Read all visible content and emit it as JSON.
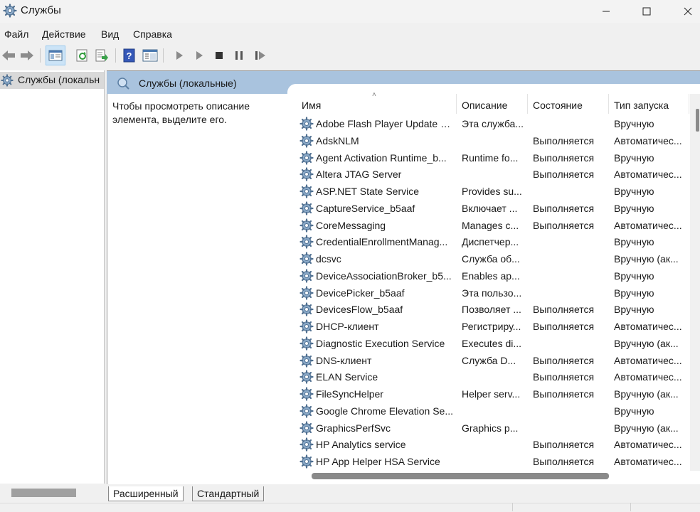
{
  "window": {
    "title": "Службы"
  },
  "menu": {
    "items": [
      "Файл",
      "Действие",
      "Вид",
      "Справка"
    ]
  },
  "tree": {
    "label": "Службы (локальн"
  },
  "panel": {
    "title": "Службы (локальные)",
    "description": "Чтобы просмотреть описание элемента, выделите его."
  },
  "table": {
    "columns": [
      "Имя",
      "Описание",
      "Состояние",
      "Тип запуска"
    ],
    "rows": [
      {
        "name": "Adobe Flash Player Update S...",
        "desc": "Эта служба...",
        "state": "",
        "start": "Вручную"
      },
      {
        "name": "AdskNLM",
        "desc": "",
        "state": "Выполняется",
        "start": "Автоматичес..."
      },
      {
        "name": "Agent Activation Runtime_b...",
        "desc": "Runtime fo...",
        "state": "Выполняется",
        "start": "Вручную"
      },
      {
        "name": "Altera JTAG Server",
        "desc": "",
        "state": "Выполняется",
        "start": "Автоматичес..."
      },
      {
        "name": "ASP.NET State Service",
        "desc": "Provides su...",
        "state": "",
        "start": "Вручную"
      },
      {
        "name": "CaptureService_b5aaf",
        "desc": "Включает ...",
        "state": "Выполняется",
        "start": "Вручную"
      },
      {
        "name": "CoreMessaging",
        "desc": "Manages c...",
        "state": "Выполняется",
        "start": "Автоматичес..."
      },
      {
        "name": "CredentialEnrollmentManag...",
        "desc": "Диспетчер...",
        "state": "",
        "start": "Вручную"
      },
      {
        "name": "dcsvc",
        "desc": "Служба об...",
        "state": "",
        "start": "Вручную (ак..."
      },
      {
        "name": "DeviceAssociationBroker_b5...",
        "desc": "Enables ap...",
        "state": "",
        "start": "Вручную"
      },
      {
        "name": "DevicePicker_b5aaf",
        "desc": "Эта пользо...",
        "state": "",
        "start": "Вручную"
      },
      {
        "name": "DevicesFlow_b5aaf",
        "desc": "Позволяет ...",
        "state": "Выполняется",
        "start": "Вручную"
      },
      {
        "name": "DHCP-клиент",
        "desc": "Регистриру...",
        "state": "Выполняется",
        "start": "Автоматичес..."
      },
      {
        "name": "Diagnostic Execution Service",
        "desc": "Executes di...",
        "state": "",
        "start": "Вручную (ак..."
      },
      {
        "name": "DNS-клиент",
        "desc": "Служба D...",
        "state": "Выполняется",
        "start": "Автоматичес..."
      },
      {
        "name": "ELAN Service",
        "desc": "",
        "state": "Выполняется",
        "start": "Автоматичес..."
      },
      {
        "name": "FileSyncHelper",
        "desc": "Helper serv...",
        "state": "Выполняется",
        "start": "Вручную (ак..."
      },
      {
        "name": "Google Chrome Elevation Se...",
        "desc": "",
        "state": "",
        "start": "Вручную"
      },
      {
        "name": "GraphicsPerfSvc",
        "desc": "Graphics p...",
        "state": "",
        "start": "Вручную (ак..."
      },
      {
        "name": "HP Analytics service",
        "desc": "",
        "state": "Выполняется",
        "start": "Автоматичес..."
      },
      {
        "name": "HP App Helper HSA Service",
        "desc": "",
        "state": "Выполняется",
        "start": "Автоматичес..."
      }
    ]
  },
  "tabs": [
    "Расширенный",
    "Стандартный"
  ],
  "icons": {
    "app": "gear-icon",
    "back": "back-arrow-icon",
    "forward": "forward-arrow-icon",
    "service": "gear-icon",
    "help": "help-icon",
    "play": "play-icon",
    "stop": "stop-icon",
    "pause": "pause-icon",
    "restart": "restart-icon"
  },
  "colors": {
    "panel_header": "#a9c3de",
    "gear": "#5b7ea3"
  }
}
